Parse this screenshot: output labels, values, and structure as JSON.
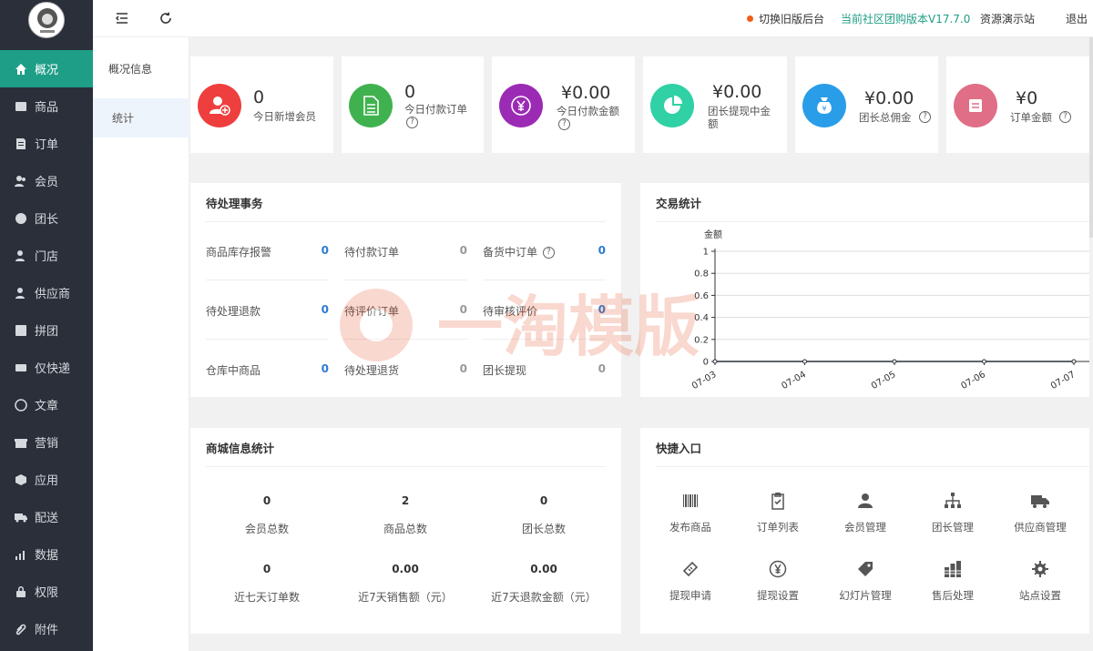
{
  "sidebar": {
    "items": [
      {
        "label": "概况",
        "icon": "home-icon"
      },
      {
        "label": "商品",
        "icon": "goods-icon"
      },
      {
        "label": "订单",
        "icon": "order-icon"
      },
      {
        "label": "会员",
        "icon": "member-icon"
      },
      {
        "label": "团长",
        "icon": "leader-icon"
      },
      {
        "label": "门店",
        "icon": "store-icon"
      },
      {
        "label": "供应商",
        "icon": "supplier-icon"
      },
      {
        "label": "拼团",
        "icon": "group-buy-icon"
      },
      {
        "label": "仅快递",
        "icon": "express-icon"
      },
      {
        "label": "文章",
        "icon": "article-icon"
      },
      {
        "label": "营销",
        "icon": "gift-icon"
      },
      {
        "label": "应用",
        "icon": "app-icon"
      },
      {
        "label": "配送",
        "icon": "truck-icon"
      },
      {
        "label": "数据",
        "icon": "chart-icon"
      },
      {
        "label": "权限",
        "icon": "lock-icon"
      },
      {
        "label": "附件",
        "icon": "attachment-icon"
      }
    ]
  },
  "subnav": {
    "items": [
      "概况信息",
      "统计"
    ]
  },
  "topbar": {
    "switch_old": "切换旧版后台",
    "version": "当前社区团购版本V17.7.0",
    "demo_site": "资源演示站",
    "logout": "退出",
    "accent": "#1f9e87",
    "dot_color": "#f25c19"
  },
  "stats": [
    {
      "value": "0",
      "label": "今日新增会员",
      "color": "#ee3e3e",
      "icon": "user-add-icon"
    },
    {
      "value": "0",
      "label": "今日付款订单",
      "color": "#3fb24f",
      "icon": "document-icon"
    },
    {
      "value": "¥0.00",
      "label": "今日付款金额",
      "color": "#9b2bb5",
      "icon": "yen-icon"
    },
    {
      "value": "¥0.00",
      "label": "团长提现中金额",
      "color": "#2fd1a5",
      "icon": "pie-icon"
    },
    {
      "value": "¥0.00",
      "label": "团长总佣金",
      "color": "#2a9de8",
      "icon": "money-bag-icon"
    },
    {
      "value": "¥0",
      "label": "订单金额",
      "color": "#e06e86",
      "icon": "note-icon"
    }
  ],
  "pending": {
    "title": "待处理事务",
    "items": [
      {
        "label": "商品库存报警",
        "value": "0"
      },
      {
        "label": "待付款订单",
        "value": "0"
      },
      {
        "label": "备货中订单",
        "value": "0"
      },
      {
        "label": "待处理退款",
        "value": "0"
      },
      {
        "label": "待评价订单",
        "value": "0"
      },
      {
        "label": "待审核评价",
        "value": "0"
      },
      {
        "label": "仓库中商品",
        "value": "0"
      },
      {
        "label": "待处理退货",
        "value": "0"
      },
      {
        "label": "团长提现",
        "value": "0"
      }
    ]
  },
  "trade": {
    "title": "交易统计"
  },
  "chart_data": {
    "type": "line",
    "title": "",
    "ylabel": "金额",
    "x": [
      "07-03",
      "07-04",
      "07-05",
      "07-06",
      "07-07"
    ],
    "y_ticks": [
      "0",
      "0.2",
      "0.4",
      "0.6",
      "0.8",
      "1"
    ],
    "series": [
      {
        "values": [
          0,
          0,
          0,
          0,
          0
        ]
      }
    ],
    "ylim": [
      0,
      1
    ],
    "grid": true
  },
  "mall": {
    "title": "商城信息统计",
    "items": [
      {
        "value": "0",
        "label": "会员总数"
      },
      {
        "value": "2",
        "label": "商品总数"
      },
      {
        "value": "0",
        "label": "团长总数"
      },
      {
        "value": "0",
        "label": "近七天订单数"
      },
      {
        "value": "0.00",
        "label": "近7天销售额（元）"
      },
      {
        "value": "0.00",
        "label": "近7天退款金额（元）"
      }
    ]
  },
  "quick": {
    "title": "快捷入口",
    "items": [
      {
        "label": "发布商品",
        "icon": "barcode-icon"
      },
      {
        "label": "订单列表",
        "icon": "clipboard-check-icon"
      },
      {
        "label": "会员管理",
        "icon": "users-icon"
      },
      {
        "label": "团长管理",
        "icon": "sitemap-icon"
      },
      {
        "label": "供应商管理",
        "icon": "truck-icon"
      },
      {
        "label": "提现申请",
        "icon": "ticket-icon"
      },
      {
        "label": "提现设置",
        "icon": "yen-circle-icon"
      },
      {
        "label": "幻灯片管理",
        "icon": "tag-icon"
      },
      {
        "label": "售后处理",
        "icon": "bars-icon"
      },
      {
        "label": "站点设置",
        "icon": "gear-icon"
      }
    ]
  },
  "watermark": {
    "text": "一淘模版"
  }
}
